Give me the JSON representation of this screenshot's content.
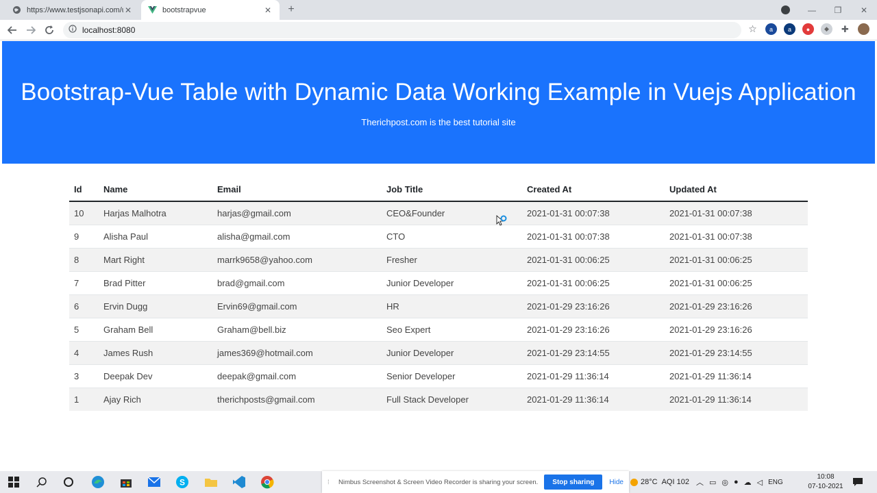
{
  "browser": {
    "tabs": [
      {
        "title": "https://www.testjsonapi.com/users"
      },
      {
        "title": "bootstrapvue"
      }
    ],
    "url": "localhost:8080"
  },
  "hero": {
    "title": "Bootstrap-Vue Table with Dynamic Data Working Example in Vuejs Application",
    "subtitle": "Therichpost.com is the best tutorial site"
  },
  "table": {
    "headers": [
      "Id",
      "Name",
      "Email",
      "Job Title",
      "Created At",
      "Updated At"
    ],
    "rows": [
      [
        "10",
        "Harjas Malhotra",
        "harjas@gmail.com",
        "CEO&Founder",
        "2021-01-31 00:07:38",
        "2021-01-31 00:07:38"
      ],
      [
        "9",
        "Alisha Paul",
        "alisha@gmail.com",
        "CTO",
        "2021-01-31 00:07:38",
        "2021-01-31 00:07:38"
      ],
      [
        "8",
        "Mart Right",
        "marrk9658@yahoo.com",
        "Fresher",
        "2021-01-31 00:06:25",
        "2021-01-31 00:06:25"
      ],
      [
        "7",
        "Brad Pitter",
        "brad@gmail.com",
        "Junior Developer",
        "2021-01-31 00:06:25",
        "2021-01-31 00:06:25"
      ],
      [
        "6",
        "Ervin Dugg",
        "Ervin69@gmail.com",
        "HR",
        "2021-01-29 23:16:26",
        "2021-01-29 23:16:26"
      ],
      [
        "5",
        "Graham Bell",
        "Graham@bell.biz",
        "Seo Expert",
        "2021-01-29 23:16:26",
        "2021-01-29 23:16:26"
      ],
      [
        "4",
        "James Rush",
        "james369@hotmail.com",
        "Junior Developer",
        "2021-01-29 23:14:55",
        "2021-01-29 23:14:55"
      ],
      [
        "3",
        "Deepak Dev",
        "deepak@gmail.com",
        "Senior Developer",
        "2021-01-29 11:36:14",
        "2021-01-29 11:36:14"
      ],
      [
        "1",
        "Ajay Rich",
        "therichposts@gmail.com",
        "Full Stack Developer",
        "2021-01-29 11:36:14",
        "2021-01-29 11:36:14"
      ]
    ]
  },
  "taskbar": {
    "share_message": "Nimbus Screenshot & Screen Video Recorder is sharing your screen.",
    "stop_label": "Stop sharing",
    "hide_label": "Hide",
    "weather": "28°C",
    "aqi": "AQI 102",
    "lang": "ENG",
    "time": "10:08",
    "date": "07-10-2021"
  },
  "colors": {
    "hero_bg": "#1a73fd",
    "stop_btn": "#1a73e8"
  }
}
